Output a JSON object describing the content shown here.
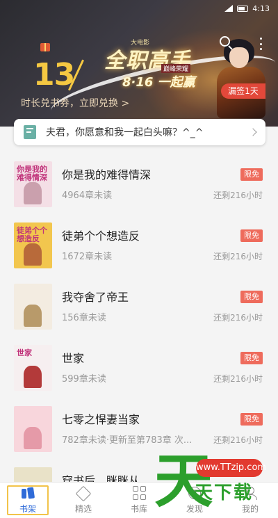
{
  "status_bar": {
    "time": "4:13"
  },
  "banner": {
    "number": "13",
    "subtitle": "时长兑书券，立即兑换 >",
    "event_small": "大电影",
    "event_title": "全职高手",
    "event_tag": "巅峰荣耀",
    "event_date": "8·16 一起赢",
    "checkin_label": "漏签1天"
  },
  "notice": {
    "text": "夫君，你愿意和我一起白头嘛？^_^"
  },
  "books": [
    {
      "title": "你是我的难得情深",
      "meta": "4964章未读",
      "badge": "限免",
      "remain": "还剩216小时",
      "cover_text": "你是我的难得情深",
      "cover_bg": "#f4dfe6",
      "cover_fig": "#caa0ad"
    },
    {
      "title": "徒弟个个想造反",
      "meta": "1672章未读",
      "badge": "限免",
      "remain": "还剩216小时",
      "cover_text": "徒弟个个想造反",
      "cover_bg": "#f2c64e",
      "cover_fig": "#b86a3a"
    },
    {
      "title": "我夺舍了帝王",
      "meta": "156章未读",
      "badge": "限免",
      "remain": "还剩216小时",
      "cover_text": "",
      "cover_bg": "#f3ece1",
      "cover_fig": "#b89a6a"
    },
    {
      "title": "世家",
      "meta": "599章未读",
      "badge": "限免",
      "remain": "还剩216小时",
      "cover_text": "世家",
      "cover_bg": "#f6eff0",
      "cover_fig": "#b33a3a"
    },
    {
      "title": "七零之悍妻当家",
      "meta": "782章未读·更新至第783章 次...",
      "badge": "限免",
      "remain": "还剩216小时",
      "cover_text": "",
      "cover_bg": "#f8d6dc",
      "cover_fig": "#e59aa8"
    },
    {
      "title": "穿书后，眯眯从",
      "meta": "",
      "badge": "",
      "remain": "",
      "cover_text": "",
      "cover_bg": "#e9e2c8",
      "cover_fig": "#b7ad85"
    }
  ],
  "nav": [
    {
      "label": "书架",
      "icon": "shelf-icon",
      "active": true
    },
    {
      "label": "精选",
      "icon": "diamond-icon",
      "active": false
    },
    {
      "label": "书库",
      "icon": "grid-icon",
      "active": false
    },
    {
      "label": "发现",
      "icon": "compass-icon",
      "active": false
    },
    {
      "label": "我的",
      "icon": "user-icon",
      "active": false
    }
  ],
  "watermark": {
    "char": "天",
    "url": "www.TTzip.com",
    "sub": "天下载"
  }
}
